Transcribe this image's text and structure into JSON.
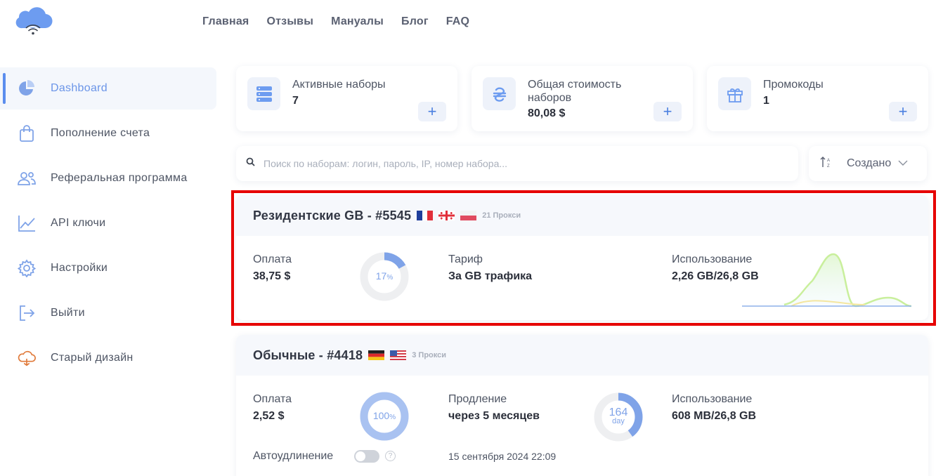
{
  "header": {
    "nav": [
      "Главная",
      "Отзывы",
      "Мануалы",
      "Блог",
      "FAQ"
    ]
  },
  "sidebar": {
    "items": [
      {
        "label": "Dashboard",
        "icon": "pie-chart-icon",
        "active": true
      },
      {
        "label": "Пополнение счета",
        "icon": "shopping-bag-icon"
      },
      {
        "label": "Реферальная программа",
        "icon": "users-icon"
      },
      {
        "label": "API ключи",
        "icon": "trend-line-icon"
      },
      {
        "label": "Настройки",
        "icon": "gear-icon"
      },
      {
        "label": "Выйти",
        "icon": "logout-icon"
      },
      {
        "label": "Старый дизайн",
        "icon": "cloud-icon"
      }
    ]
  },
  "stats": [
    {
      "title": "Активные наборы",
      "value": "7",
      "icon": "server-icon"
    },
    {
      "title": "Общая стоимость наборов",
      "value": "80,08 $",
      "icon": "hryvnia-icon"
    },
    {
      "title": "Промокоды",
      "value": "1",
      "icon": "gift-icon"
    }
  ],
  "stat_add_label": "+",
  "search": {
    "placeholder": "Поиск по наборам: логин, пароль, IP, номер набора..."
  },
  "sort": {
    "label": "Создано"
  },
  "sets": [
    {
      "name": "Резидентские GB - #5545",
      "flags": [
        "France",
        "Georgia",
        "Poland"
      ],
      "proxies": "21 Прокси",
      "payment_label": "Оплата",
      "payment_value": "38,75 $",
      "ring_percent": 17,
      "ring_text": "17",
      "ring_unit": "%",
      "tariff_label": "Тариф",
      "tariff_value": "За GB трафика",
      "usage_label": "Использование",
      "usage_value": "2,26 GB/26,8 GB"
    },
    {
      "name": "Обычные - #4418",
      "flags": [
        "Germany",
        "USA"
      ],
      "proxies": "3 Прокси",
      "payment_label": "Оплата",
      "payment_value": "2,52 $",
      "ring_percent": 100,
      "ring_text": "100",
      "ring_unit": "%",
      "renew_label": "Продление",
      "renew_value": "через 5 месяцев",
      "days_percent": 40,
      "days_text": "164",
      "days_unit": "day",
      "usage_label": "Использование",
      "usage_value": "608 MB/26,8 GB",
      "autorenew_label": "Автоудлинение",
      "autorenew_on": false,
      "help_glyph": "?",
      "date": "15 сентября 2024 22:09"
    }
  ],
  "colors": {
    "accent": "#5b8dee",
    "highlight": "#e60000",
    "ring": "#7fa3e8"
  }
}
